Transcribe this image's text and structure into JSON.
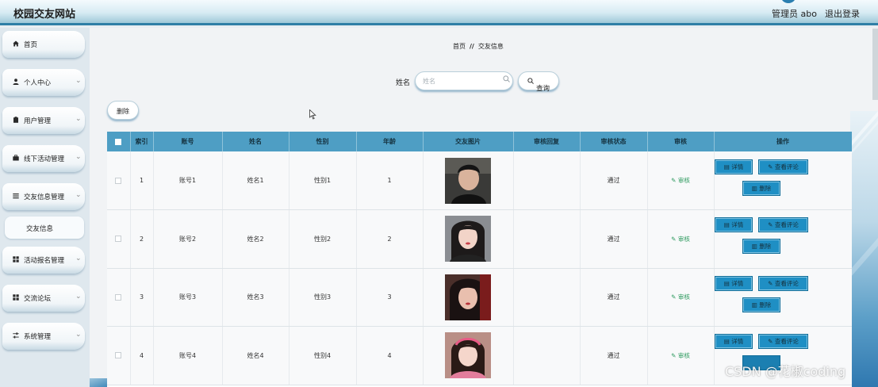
{
  "header": {
    "site_title": "校园交友网站",
    "admin_label": "管理员 abo",
    "logout_label": "退出登录"
  },
  "sidebar": {
    "items": [
      {
        "label": "首页",
        "icon": "home-icon",
        "has_chevron": false
      },
      {
        "label": "个人中心",
        "icon": "user-icon",
        "has_chevron": true
      },
      {
        "label": "用户管理",
        "icon": "clipboard-icon",
        "has_chevron": true
      },
      {
        "label": "线下活动管理",
        "icon": "briefcase-icon",
        "has_chevron": true
      },
      {
        "label": "交友信息管理",
        "icon": "list-icon",
        "has_chevron": true
      },
      {
        "label": "活动报名管理",
        "icon": "grid-icon",
        "has_chevron": true
      },
      {
        "label": "交流论坛",
        "icon": "grid-icon",
        "has_chevron": true
      },
      {
        "label": "系统管理",
        "icon": "sliders-icon",
        "has_chevron": true
      }
    ],
    "sub_item": {
      "label": "交友信息"
    }
  },
  "breadcrumb": {
    "home": "首页",
    "separator": "//",
    "current": "交友信息"
  },
  "search": {
    "label": "姓名",
    "placeholder": "姓名",
    "value": "",
    "button_label": "查询"
  },
  "toolbar": {
    "delete_label": "删除"
  },
  "table": {
    "headers": [
      "",
      "索引",
      "账号",
      "姓名",
      "性别",
      "年龄",
      "交友图片",
      "审核回复",
      "审核状态",
      "审核",
      "操作"
    ],
    "audit_link_label": "审核",
    "actions": {
      "detail": "详情",
      "comments": "查看评论",
      "delete": "删除"
    },
    "rows": [
      {
        "index": "1",
        "account": "账号1",
        "name": "姓名1",
        "gender": "性别1",
        "age": "1",
        "reply": "",
        "status": "通过"
      },
      {
        "index": "2",
        "account": "账号2",
        "name": "姓名2",
        "gender": "性别2",
        "age": "2",
        "reply": "",
        "status": "通过"
      },
      {
        "index": "3",
        "account": "账号3",
        "name": "姓名3",
        "gender": "性别3",
        "age": "3",
        "reply": "",
        "status": "通过"
      },
      {
        "index": "4",
        "account": "账号4",
        "name": "姓名4",
        "gender": "性别4",
        "age": "4",
        "reply": "",
        "status": "通过"
      }
    ]
  },
  "watermark": "CSDN @花椒coding",
  "colors": {
    "table_header": "#4e9ec4",
    "action_button": "#1f8fc4",
    "audit_link": "#2e9a5f",
    "header_border": "#2f7fa6"
  }
}
